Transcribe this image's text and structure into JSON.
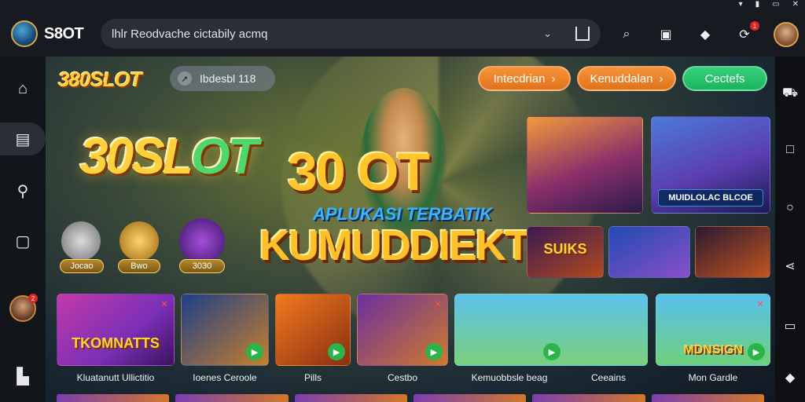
{
  "system_bar": {
    "icons": [
      "wifi-icon",
      "battery-icon",
      "window-icon",
      "close-icon"
    ]
  },
  "header": {
    "brand_name": "S8OT",
    "address": "lhlr  Reodvache cictabily acmq",
    "icons": [
      "search-icon",
      "screen-icon",
      "diamond-icon",
      "refresh-icon"
    ],
    "notification_badge": "1"
  },
  "nav": {
    "items": [
      "home-icon",
      "casino-icon",
      "search-icon",
      "chat-icon",
      "lobby-icon"
    ],
    "avatar_badge": "2"
  },
  "main": {
    "logo_small": "380SLOT",
    "search_pill": "Ibdesbl 118",
    "buttons": [
      {
        "label": "Intecdrian",
        "arrow": "›"
      },
      {
        "label": "Kenuddalan",
        "arrow": "›"
      },
      {
        "label": "Cectefs"
      }
    ],
    "big_logo_a": "30SL",
    "big_logo_b": "OT",
    "hero_title": "30 OT",
    "hero_sub": "APLUKASI TERBATIK",
    "hero_brand": "KUMUDDIEKTS",
    "coins": [
      "Jocao",
      "Bwo",
      "3030"
    ],
    "featured": [
      {
        "caption": ""
      },
      {
        "caption": "MUIDLOLAC BLCOE"
      }
    ],
    "mini_cards": [
      {
        "title": "SUIKS"
      },
      {
        "title": ""
      },
      {
        "title": ""
      }
    ],
    "game_cards": [
      {
        "art": "TKOMNATTS",
        "label": "Kluatanutt Ullictitio"
      },
      {
        "art": "",
        "label": "Ioenes Ceroole"
      },
      {
        "art": "",
        "label": "Pills"
      },
      {
        "art": "",
        "label": "Cestbo"
      },
      {
        "art": "",
        "label": "Kemuobbsle beag"
      },
      {
        "art": "",
        "label": "Ceeains"
      },
      {
        "art": "MDNSIGN",
        "label": "Mon Gardle"
      }
    ]
  },
  "colors": {
    "orange": "#ef8226",
    "green": "#27c46b",
    "gold": "#ffcf3d"
  }
}
